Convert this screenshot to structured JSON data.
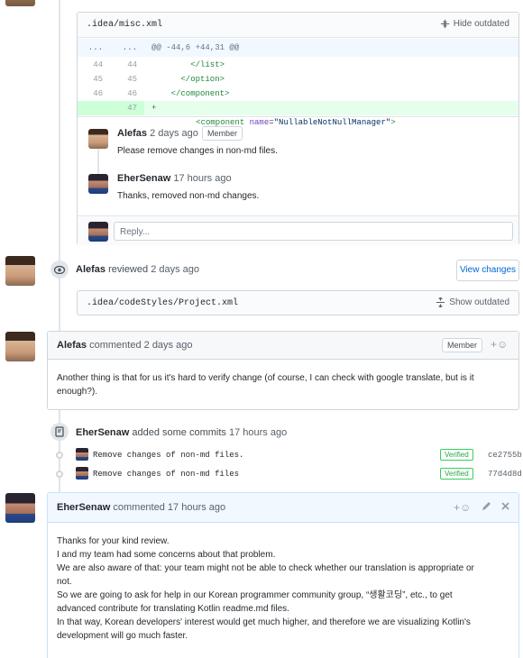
{
  "top_file_box": {
    "filename": ".idea/misc.xml",
    "toggle_label": "Hide outdated",
    "hunk": {
      "old": "...",
      "new": "...",
      "header": "@@ -44,6 +44,31 @@"
    },
    "lines": [
      {
        "old": "44",
        "new": "44",
        "code": "        </list>"
      },
      {
        "old": "45",
        "new": "45",
        "code": "      </option>"
      },
      {
        "old": "46",
        "new": "46",
        "code": "    </component>"
      }
    ],
    "added_line": {
      "new": "47",
      "sign": "+",
      "pre": "  <component ",
      "attr": "name",
      "eq": "=",
      "value": "\"NullableNotNullManager\"",
      "post": ">"
    }
  },
  "thread": [
    {
      "author": "Alefas",
      "time": "2 days ago",
      "badge": "Member",
      "body": "Please remove changes in non-md files."
    },
    {
      "author": "EherSenaw",
      "time": "17 hours ago",
      "body": "Thanks, removed non-md changes."
    }
  ],
  "reply": {
    "placeholder": "Reply..."
  },
  "review_event": {
    "author": "Alefas",
    "action": "reviewed",
    "time": "2 days ago",
    "button": "View changes"
  },
  "second_file_box": {
    "filename": ".idea/codeStyles/Project.xml",
    "toggle_label": "Show outdated"
  },
  "comment1": {
    "author": "Alefas",
    "action": "commented",
    "time": "2 days ago",
    "badge": "Member",
    "reaction": "+☺",
    "body": "Another thing is that for us it's hard to verify change (of course, I can check with google translate, but is it enough?)."
  },
  "commits_event": {
    "author": "EherSenaw",
    "action": "added some commits",
    "time": "17 hours ago",
    "commits": [
      {
        "message": "Remove changes of non-md files.",
        "status": "Verified",
        "sha": "ce2755b"
      },
      {
        "message": "Remove changes of non-md files",
        "status": "Verified",
        "sha": "77d4d8d"
      }
    ]
  },
  "comment2": {
    "author": "EherSenaw",
    "action": "commented",
    "time": "17 hours ago",
    "reaction": "+☺",
    "body_lines": [
      "Thanks for your kind review.",
      "I and my team had some concerns about that problem.",
      "We are also aware of that: your team might not be able to check whether our translation is appropriate or",
      "not.",
      "So we are going to ask for help in our Korean programmer community group, “생활코딩”, etc., to get",
      "advanced contribute for translating Kotlin readme.md files.",
      "In that way, Korean developers' interest would get much higher, and therefore we are visualizing Kotlin's",
      "development will go much faster."
    ]
  },
  "colors": {
    "link": "#0366d6",
    "verified": "#28a745",
    "added_bg": "#e6ffed",
    "hunk_bg": "#f1f8ff"
  }
}
